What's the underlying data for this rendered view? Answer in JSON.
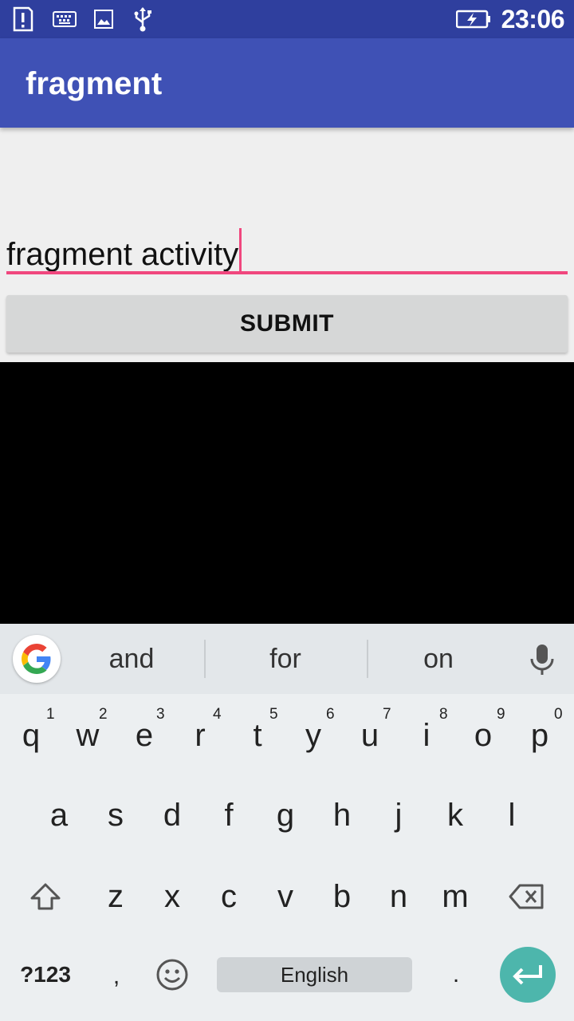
{
  "status_bar": {
    "time": "23:06",
    "icons": [
      "alert-icon",
      "keyboard-icon",
      "image-icon",
      "usb-icon",
      "battery-charging-icon"
    ]
  },
  "app_bar": {
    "title": "fragment"
  },
  "form": {
    "input_value": "fragment activity",
    "submit_label": "SUBMIT"
  },
  "colors": {
    "status_bar": "#2f3f9e",
    "app_bar": "#3f51b5",
    "accent": "#f0477e",
    "button": "#d6d7d7",
    "enter_key": "#4db6ac"
  },
  "keyboard": {
    "suggestions": [
      "and",
      "for",
      "on"
    ],
    "row1": [
      {
        "k": "q",
        "h": "1"
      },
      {
        "k": "w",
        "h": "2"
      },
      {
        "k": "e",
        "h": "3"
      },
      {
        "k": "r",
        "h": "4"
      },
      {
        "k": "t",
        "h": "5"
      },
      {
        "k": "y",
        "h": "6"
      },
      {
        "k": "u",
        "h": "7"
      },
      {
        "k": "i",
        "h": "8"
      },
      {
        "k": "o",
        "h": "9"
      },
      {
        "k": "p",
        "h": "0"
      }
    ],
    "row2": [
      "a",
      "s",
      "d",
      "f",
      "g",
      "h",
      "j",
      "k",
      "l"
    ],
    "row3": [
      "z",
      "x",
      "c",
      "v",
      "b",
      "n",
      "m"
    ],
    "symbols_label": "?123",
    "comma": ",",
    "space_label": "English",
    "period": "."
  }
}
